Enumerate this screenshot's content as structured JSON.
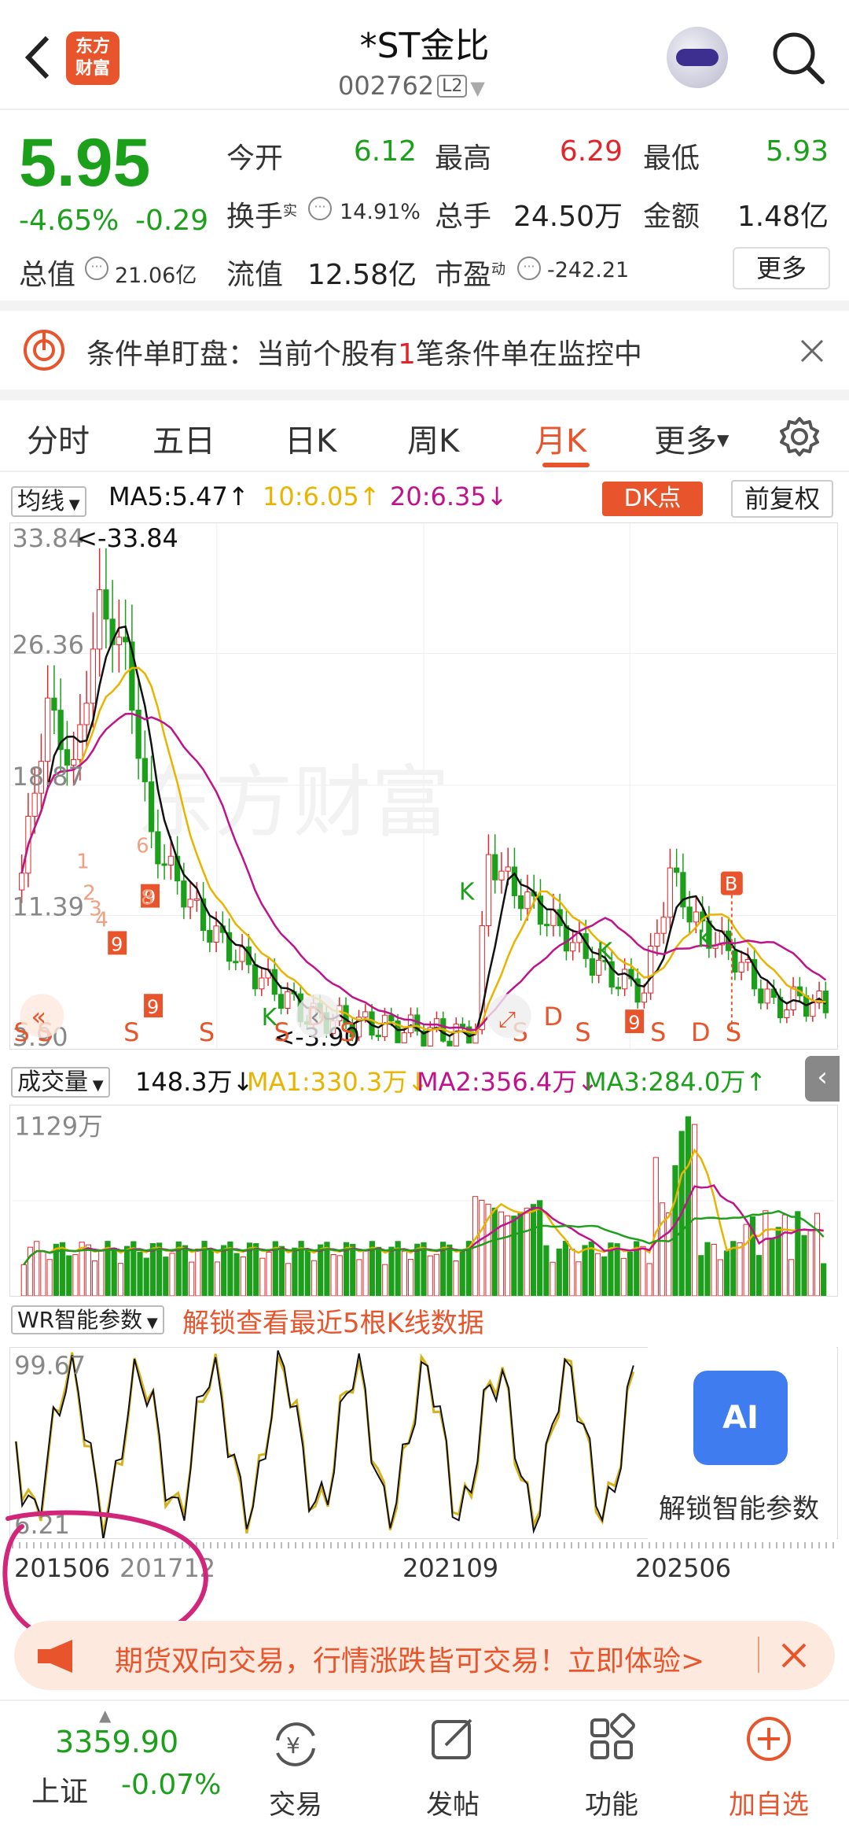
{
  "header": {
    "logo_text_1": "东方",
    "logo_text_2": "财富",
    "title": "*ST金比",
    "code": "002762",
    "level_badge": "L2"
  },
  "quote": {
    "price": "5.95",
    "change_pct": "-4.65%",
    "change_abs": "-0.29",
    "open_label": "今开",
    "open_value": "6.12",
    "high_label": "最高",
    "high_value": "6.29",
    "low_label": "最低",
    "low_value": "5.93",
    "turnover_label": "换手",
    "turnover_sup": "实",
    "turnover_value": "14.91%",
    "volume_label": "总手",
    "volume_value": "24.50万",
    "amount_label": "金额",
    "amount_value": "1.48亿",
    "mktcap_label": "总值",
    "mktcap_value": "21.06亿",
    "float_label": "流值",
    "float_value": "12.58亿",
    "pe_label": "市盈",
    "pe_sup": "动",
    "pe_value": "-242.21",
    "more_label": "更多"
  },
  "condition_bar": {
    "prefix": "条件单盯盘：当前个股有",
    "count": "1",
    "suffix": "笔条件单在监控中"
  },
  "tabs": [
    {
      "label": "分时"
    },
    {
      "label": "五日"
    },
    {
      "label": "日K"
    },
    {
      "label": "周K"
    },
    {
      "label": "月K"
    },
    {
      "label": "更多"
    }
  ],
  "kline": {
    "indicator": "均线",
    "ma5": "MA5:5.47",
    "ma10": "10:6.05",
    "ma20": "20:6.35",
    "dk_label": "DK点",
    "fq_label": "前复权",
    "y_labels": [
      "33.84",
      "26.36",
      "18.87",
      "11.39",
      "3.90"
    ],
    "max_marker": "<-33.84",
    "min_marker": "<-3.90",
    "watermark": "东方财富",
    "buy_marker": "B"
  },
  "volume": {
    "indicator": "成交量",
    "current": "148.3万",
    "ma1": "MA1:330.3万",
    "ma2": "MA2:356.4万",
    "ma3": "MA3:284.0万",
    "y_top": "1129万"
  },
  "wr": {
    "indicator": "WR智能参数",
    "unlock_text": "解锁查看最近5根K线数据",
    "y_top": "99.67",
    "y_bottom": "6.21",
    "ai_label": "AI",
    "ai_caption": "解锁智能参数"
  },
  "x_axis": [
    "201506",
    "201712",
    "202109",
    "202506"
  ],
  "banner": {
    "text": "期货双向交易，行情涨跌皆可交易！立即体验>"
  },
  "bottom_nav": {
    "index_value": "3359.90",
    "index_name": "上证",
    "index_change": "-0.07%",
    "items": [
      {
        "label": "交易"
      },
      {
        "label": "发帖"
      },
      {
        "label": "功能"
      },
      {
        "label": "加自选"
      }
    ]
  },
  "colors": {
    "up": "#e0262b",
    "down": "#1ca01c",
    "accent": "#e8542b",
    "ma5": "#111111",
    "ma10": "#e8b400",
    "ma20": "#c0128c"
  }
}
